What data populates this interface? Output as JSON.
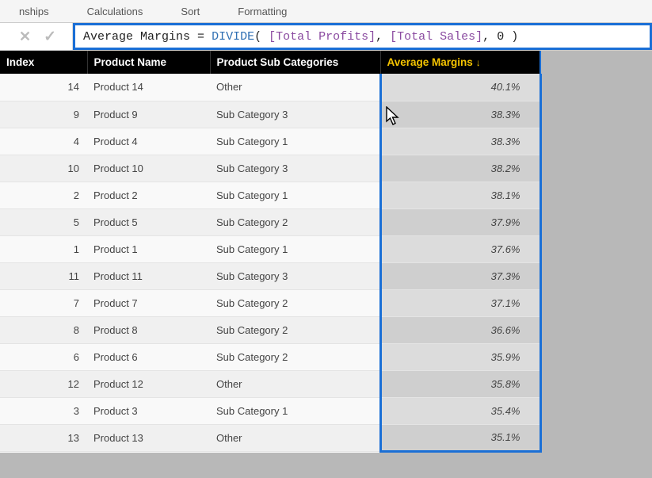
{
  "ribbon": {
    "items": [
      "nships",
      "Calculations",
      "Sort",
      "Formatting"
    ]
  },
  "formula": {
    "measure_name": "Average Margins",
    "equals": " = ",
    "func": "DIVIDE",
    "open": "( ",
    "ref1": "[Total Profits]",
    "sep1": ", ",
    "ref2": "[Total Sales]",
    "sep2": ", ",
    "arg3": "0",
    "close": " )"
  },
  "table": {
    "headers": {
      "index": "Index",
      "name": "Product Name",
      "sub": "Product Sub Categories",
      "margin": "Average Margins"
    },
    "rows": [
      {
        "index": "14",
        "name": "Product 14",
        "sub": "Other",
        "margin": "40.1%"
      },
      {
        "index": "9",
        "name": "Product 9",
        "sub": "Sub Category 3",
        "margin": "38.3%"
      },
      {
        "index": "4",
        "name": "Product 4",
        "sub": "Sub Category 1",
        "margin": "38.3%"
      },
      {
        "index": "10",
        "name": "Product 10",
        "sub": "Sub Category 3",
        "margin": "38.2%"
      },
      {
        "index": "2",
        "name": "Product 2",
        "sub": "Sub Category 1",
        "margin": "38.1%"
      },
      {
        "index": "5",
        "name": "Product 5",
        "sub": "Sub Category 2",
        "margin": "37.9%"
      },
      {
        "index": "1",
        "name": "Product 1",
        "sub": "Sub Category 1",
        "margin": "37.6%"
      },
      {
        "index": "11",
        "name": "Product 11",
        "sub": "Sub Category 3",
        "margin": "37.3%"
      },
      {
        "index": "7",
        "name": "Product 7",
        "sub": "Sub Category 2",
        "margin": "37.1%"
      },
      {
        "index": "8",
        "name": "Product 8",
        "sub": "Sub Category 2",
        "margin": "36.6%"
      },
      {
        "index": "6",
        "name": "Product 6",
        "sub": "Sub Category 2",
        "margin": "35.9%"
      },
      {
        "index": "12",
        "name": "Product 12",
        "sub": "Other",
        "margin": "35.8%"
      },
      {
        "index": "3",
        "name": "Product 3",
        "sub": "Sub Category 1",
        "margin": "35.4%"
      },
      {
        "index": "13",
        "name": "Product 13",
        "sub": "Other",
        "margin": "35.1%"
      }
    ]
  }
}
